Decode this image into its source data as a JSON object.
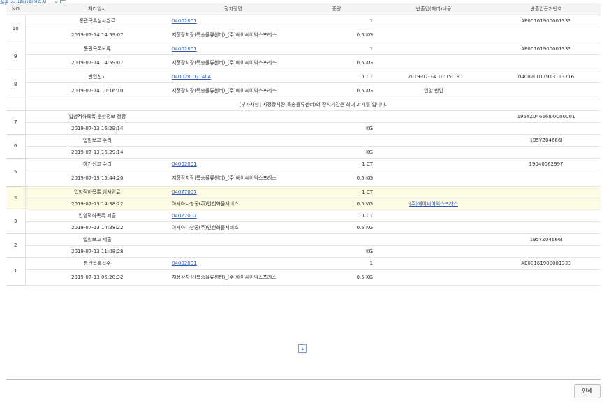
{
  "top_tab": {
    "label": "화물 추가란채팅업요청 ... ×"
  },
  "headers": [
    "NO",
    "처리일시",
    "장치장명",
    "중량",
    "반출입(처리)내용",
    "반출입근거번호"
  ],
  "records": [
    {
      "no": "10",
      "status": "통관목록심사완료",
      "datetime": "2019-07-14 14:59:07",
      "warehouse_code": "04002001",
      "warehouse_name": "지정장치장(특송물류센터)_(주)에이씨이익스프레스",
      "qty": "1",
      "weight": "0.5 KG",
      "detail1": "",
      "detail2": "",
      "ref": "AE00161900001333"
    },
    {
      "no": "9",
      "status": "통관목록보류",
      "datetime": "2019-07-14 14:59:07",
      "warehouse_code": "04002001",
      "warehouse_name": "지정장치장(특송물류센터)_(주)에이씨이익스프레스",
      "qty": "1",
      "weight": "0.5 KG",
      "detail1": "",
      "detail2": "",
      "ref": "AE00161900001333"
    },
    {
      "no": "8",
      "status": "반입신고",
      "datetime": "2019-07-14 10:16:10",
      "warehouse_code": "04002001/1ALA",
      "warehouse_name": "지정장치장(특송물류센터)_(주)에이씨이익스프레스",
      "qty": "1 CT",
      "weight": "0.5 KG",
      "detail1": "2019-07-14 10:15:18",
      "detail2": "입항 반입",
      "ref": "040020011913113716"
    },
    {
      "no": "7",
      "status": "입항적하목록 운항정보 정정",
      "datetime": "2019-07-13 16:29:14",
      "warehouse_code": "",
      "warehouse_name": "",
      "qty": "",
      "weight": "KG",
      "detail1": "",
      "detail2": "",
      "ref": "195YZ04666I00C00001"
    },
    {
      "no": "6",
      "status": "입항보고 수리",
      "datetime": "2019-07-13 16:29:14",
      "warehouse_code": "",
      "warehouse_name": "",
      "qty": "",
      "weight": "KG",
      "detail1": "",
      "detail2": "",
      "ref": "195YZ04666I"
    },
    {
      "no": "5",
      "status": "하기신고 수리",
      "datetime": "2019-07-13 15:44:20",
      "warehouse_code": "04002001",
      "warehouse_name": "지정장치장(특송물류센터)_(주)에이씨이익스프레스",
      "qty": "1 CT",
      "weight": "0.5 KG",
      "detail1": "",
      "detail2": "",
      "ref": "19040062997"
    },
    {
      "no": "4",
      "status": "입항적하목록 심사완료",
      "datetime": "2019-07-13 14:38:22",
      "warehouse_code": "04077007",
      "warehouse_name": "아시아나항공(주)인천화물서비스",
      "qty": "1 CT",
      "weight": "0.5 KG",
      "detail1": "",
      "detail2": "(주)에이씨이익스프레스",
      "ref": ""
    },
    {
      "no": "3",
      "status": "입항적하목록 제출",
      "datetime": "2019-07-13 14:38:22",
      "warehouse_code": "04077007",
      "warehouse_name": "아시아나항공(주)인천화물서비스",
      "qty": "1 CT",
      "weight": "0.5 KG",
      "detail1": "",
      "detail2": "",
      "ref": ""
    },
    {
      "no": "2",
      "status": "입항보고 제출",
      "datetime": "2019-07-13 11:08:28",
      "warehouse_code": "",
      "warehouse_name": "",
      "qty": "",
      "weight": "KG",
      "detail1": "",
      "detail2": "",
      "ref": "195YZ04666I"
    },
    {
      "no": "1",
      "status": "통관목록접수",
      "datetime": "2019-07-13 05:28:32",
      "warehouse_code": "04002001",
      "warehouse_name": "지정장치장(특송물류센터)_(주)에이씨이익스프레스",
      "qty": "1",
      "weight": "0.5 KG",
      "detail1": "",
      "detail2": "",
      "ref": "AE00161900001333"
    }
  ],
  "note_after_8": "[부가사항] 지정장치장(특송물류센터)의 장치기간은 최대 2 개월 입니다.",
  "selected_no": "4",
  "pagination": {
    "current": "1"
  },
  "print_button": "인쇄",
  "colors": {
    "link": "#2b5fb8",
    "selected_row": "#fdfbe3",
    "header_bg": "#f4f4f4"
  }
}
